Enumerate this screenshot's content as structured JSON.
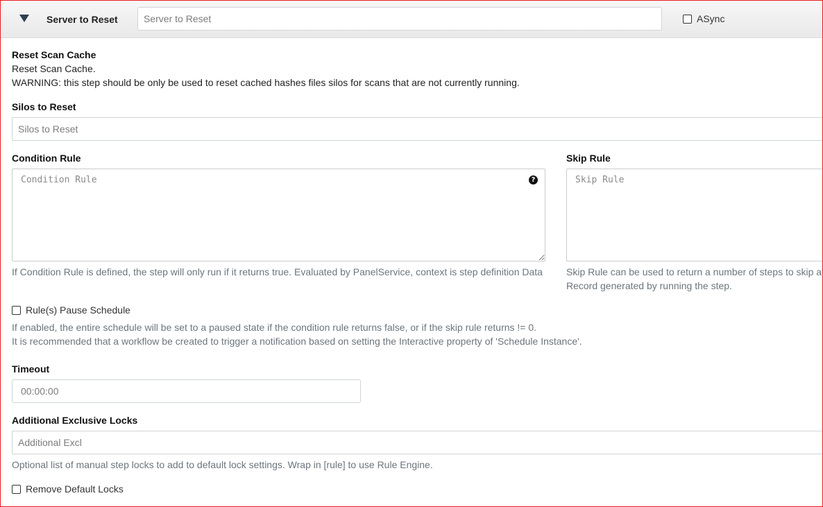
{
  "header": {
    "title": "Server to Reset",
    "server_placeholder": "Server to Reset",
    "async_label": "ASync"
  },
  "step": {
    "name": "Reset Scan Cache",
    "description": "Reset Scan Cache.",
    "warning": "WARNING: this step should be only be used to reset cached hashes files silos for scans that are not currently running."
  },
  "silos": {
    "label": "Silos to Reset",
    "placeholder": "Silos to Reset"
  },
  "condition_rule": {
    "label": "Condition Rule",
    "placeholder": "Condition Rule",
    "help": "If Condition Rule is defined, the step will only run if it returns true. Evaluated by PanelService, context is step definition Data",
    "help_icon": "question-circle-icon"
  },
  "skip_rule": {
    "label": "Skip Rule",
    "placeholder": "Skip Rule",
    "help_line1": "Skip Rule can be used to return a number of steps to skip at",
    "help_line2": "Record generated by running the step."
  },
  "pause_schedule": {
    "label": "Rule(s) Pause Schedule",
    "help_line1": "If enabled, the entire schedule will be set to a paused state if the condition rule returns false, or if the skip rule returns != 0.",
    "help_line2": "It is recommended that a workflow be created to trigger a notification based on setting the Interactive property of 'Schedule Instance'."
  },
  "timeout": {
    "label": "Timeout",
    "placeholder": "00:00:00"
  },
  "locks": {
    "label": "Additional Exclusive Locks",
    "placeholder": "Additional Excl",
    "help": "Optional list of manual step locks to add to default lock settings. Wrap in [rule] to use Rule Engine."
  },
  "remove_default_locks": {
    "label": "Remove Default Locks"
  },
  "colors": {
    "frame_border": "#e8191f",
    "header_bg": "#efefef",
    "help_text": "#6c757d"
  }
}
